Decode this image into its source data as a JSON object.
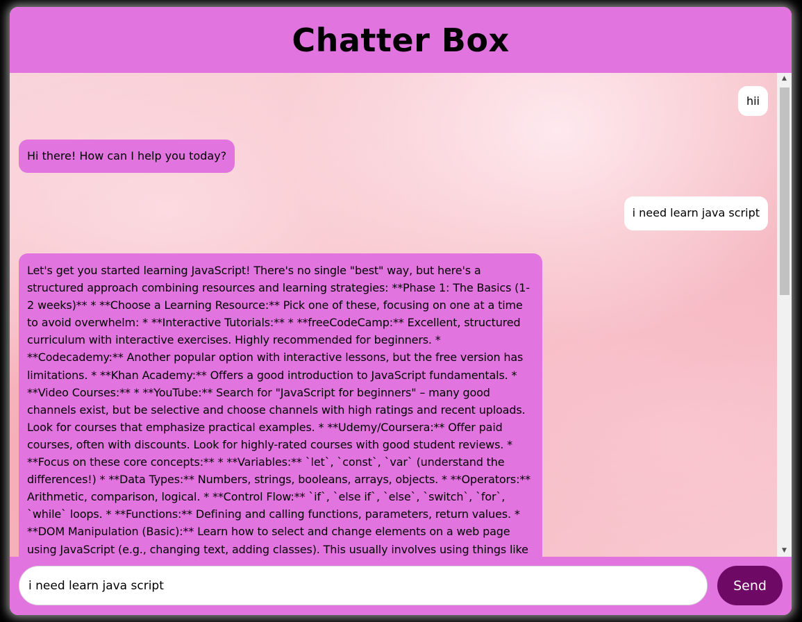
{
  "header": {
    "title": "Chatter Box"
  },
  "messages": [
    {
      "role": "user",
      "text": "hii"
    },
    {
      "role": "bot",
      "text": "Hi there! How can I help you today?"
    },
    {
      "role": "user",
      "text": "i need learn java script"
    },
    {
      "role": "bot",
      "text": "Let's get you started learning JavaScript! There's no single \"best\" way, but here's a structured approach combining resources and learning strategies: **Phase 1: The Basics (1-2 weeks)** * **Choose a Learning Resource:** Pick one of these, focusing on one at a time to avoid overwhelm: * **Interactive Tutorials:** * **freeCodeCamp:** Excellent, structured curriculum with interactive exercises. Highly recommended for beginners. * **Codecademy:** Another popular option with interactive lessons, but the free version has limitations. * **Khan Academy:** Offers a good introduction to JavaScript fundamentals. * **Video Courses:** * **YouTube:** Search for \"JavaScript for beginners\" – many good channels exist, but be selective and choose channels with high ratings and recent uploads. Look for courses that emphasize practical examples. * **Udemy/Coursera:** Offer paid courses, often with discounts. Look for highly-rated courses with good student reviews. * **Focus on these core concepts:** * **Variables:** `let`, `const`, `var` (understand the differences!) * **Data Types:** Numbers, strings, booleans, arrays, objects. * **Operators:** Arithmetic, comparison, logical. * **Control Flow:** `if`, `else if`, `else`, `switch`, `for`, `while` loops. * **Functions:** Defining and calling functions, parameters, return values. * **DOM Manipulation (Basic):** Learn how to select and change elements on a web page using JavaScript (e.g., changing text, adding classes). This usually involves using things like"
    }
  ],
  "composer": {
    "input_value": "i need learn java script",
    "send_label": "Send"
  },
  "colors": {
    "header_bg": "#e274e0",
    "bot_bubble": "#e274e0",
    "user_bubble": "#ffffff",
    "send_button": "#6e0a66"
  },
  "icons": {
    "scroll_up": "scroll-up-arrow-icon",
    "scroll_down": "scroll-down-arrow-icon"
  }
}
